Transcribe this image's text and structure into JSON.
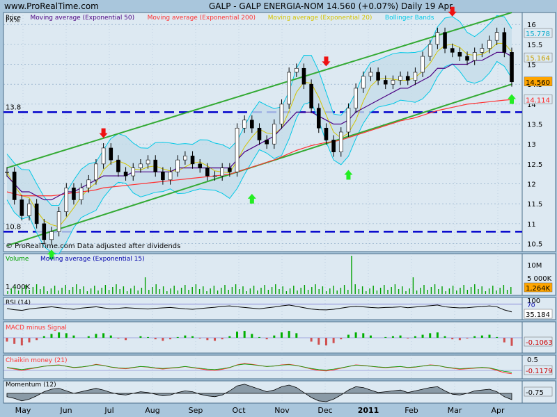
{
  "header": {
    "site": "www.ProRealTime.com",
    "title": "GALP - GALP ENERGIA-NOM   14.560 (+0.07%)   Daily  19 Apr"
  },
  "chart_data": [
    {
      "type": "line",
      "name": "price-panel",
      "legend": [
        {
          "label": "Price",
          "color": "#000000"
        },
        {
          "label": "Moving average (Exponential 50)",
          "color": "#4b0082"
        },
        {
          "label": "Moving average (Exponential 200)",
          "color": "#ff3333"
        },
        {
          "label": "Moving average (Exponential 20)",
          "color": "#d4c400"
        },
        {
          "label": "Bollinger Bands",
          "color": "#00c8e6"
        }
      ],
      "yticks": [
        10.5,
        11,
        11.5,
        12,
        12.5,
        13,
        13.5,
        14,
        14.5,
        15,
        15.5,
        16
      ],
      "ylim": [
        10.3,
        16.3
      ],
      "x_months": [
        "May",
        "Jun",
        "Jul",
        "Aug",
        "Sep",
        "Oct",
        "Nov",
        "Dec",
        "2011",
        "Feb",
        "Mar",
        "Apr"
      ],
      "horizontal_levels": [
        13.8,
        10.8
      ],
      "labels": {
        "last_price": "14.560",
        "bb_upper": "15.778",
        "bb_mid": "15.164",
        "ema200": "14.114",
        "level_hi": "13.8",
        "level_lo": "10.8",
        "note": "© ProRealTime.com  Data adjusted after dividends",
        "pct": "PX%"
      },
      "price_series": [
        12.3,
        11.6,
        11.2,
        11.5,
        11.0,
        10.6,
        10.8,
        11.3,
        11.9,
        11.6,
        11.9,
        12.1,
        12.5,
        12.9,
        12.6,
        12.3,
        12.2,
        12.4,
        12.5,
        12.6,
        12.3,
        12.1,
        12.3,
        12.6,
        12.7,
        12.5,
        12.4,
        12.2,
        12.2,
        12.4,
        12.3,
        13.4,
        13.6,
        13.4,
        13.1,
        13.0,
        13.5,
        14.0,
        14.8,
        14.9,
        14.5,
        13.9,
        13.4,
        13.1,
        12.8,
        13.3,
        13.9,
        14.4,
        14.7,
        14.8,
        14.6,
        14.5,
        14.6,
        14.7,
        14.6,
        14.8,
        15.2,
        15.5,
        15.8,
        15.4,
        15.3,
        15.2,
        15.1,
        15.3,
        15.4,
        15.6,
        15.8,
        15.3,
        14.56
      ],
      "ema50": [
        12.2,
        12.0,
        11.8,
        11.8,
        11.7,
        11.6,
        11.6,
        11.7,
        11.8,
        11.8,
        11.9,
        12.0,
        12.1,
        12.2,
        12.2,
        12.2,
        12.2,
        12.3,
        12.3,
        12.3,
        12.3,
        12.3,
        12.3,
        12.4,
        12.4,
        12.4,
        12.4,
        12.4,
        12.4,
        12.4,
        12.4,
        12.6,
        12.8,
        12.9,
        13.0,
        13.1,
        13.2,
        13.4,
        13.6,
        13.8,
        13.8,
        13.8,
        13.7,
        13.6,
        13.5,
        13.5,
        13.6,
        13.8,
        13.9,
        14.0,
        14.1,
        14.2,
        14.3,
        14.4,
        14.4,
        14.5,
        14.6,
        14.7,
        14.9,
        14.9,
        15.0,
        15.0,
        15.0,
        15.1,
        15.1,
        15.2,
        15.3,
        15.3,
        15.2
      ],
      "ema200": [
        11.8,
        11.75,
        11.7,
        11.7,
        11.7,
        11.7,
        11.7,
        11.72,
        11.75,
        11.78,
        11.8,
        11.82,
        11.85,
        11.9,
        11.92,
        11.94,
        11.96,
        11.98,
        12.0,
        12.02,
        12.04,
        12.06,
        12.08,
        12.1,
        12.12,
        12.14,
        12.16,
        12.18,
        12.2,
        12.22,
        12.24,
        12.3,
        12.36,
        12.42,
        12.48,
        12.54,
        12.6,
        12.68,
        12.76,
        12.84,
        12.9,
        12.96,
        13.0,
        13.04,
        13.06,
        13.1,
        13.16,
        13.22,
        13.28,
        13.34,
        13.4,
        13.46,
        13.52,
        13.58,
        13.62,
        13.66,
        13.72,
        13.78,
        13.84,
        13.88,
        13.92,
        13.96,
        14.0,
        14.02,
        14.04,
        14.06,
        14.08,
        14.1,
        14.114
      ],
      "channel": {
        "upper": [
          [
            0,
            12.4
          ],
          [
            68,
            16.3
          ]
        ],
        "lower": [
          [
            0,
            10.45
          ],
          [
            68,
            14.5
          ]
        ]
      },
      "arrows_down": [
        [
          13,
          13.15
        ],
        [
          43,
          14.95
        ],
        [
          60,
          16.2
        ]
      ],
      "arrows_up": [
        [
          6,
          10.35
        ],
        [
          33,
          11.75
        ],
        [
          46,
          12.35
        ],
        [
          68,
          14.25
        ]
      ]
    },
    {
      "type": "bar",
      "name": "volume-panel",
      "legend": [
        {
          "label": "Volume",
          "color": "#00a000"
        },
        {
          "label": "Moving average (Exponential 15)",
          "color": "#0000aa"
        }
      ],
      "yticks_labels": [
        "10M",
        "5 000K",
        "1,400K"
      ],
      "last_label": "1,264K"
    },
    {
      "type": "line",
      "name": "rsi-panel",
      "legend": [
        {
          "label": "RSI (14)",
          "color": "#000000"
        }
      ],
      "ticks": [
        "100",
        "70"
      ],
      "last_label": "35.184",
      "values": [
        50,
        45,
        42,
        48,
        52,
        55,
        58,
        54,
        50,
        47,
        52,
        55,
        58,
        53,
        49,
        51,
        54,
        52,
        50,
        48,
        51,
        53,
        55,
        52,
        49,
        47,
        50,
        53,
        56,
        60,
        62,
        58,
        55,
        52,
        49,
        53,
        57,
        62,
        66,
        60,
        54,
        48,
        45,
        44,
        47,
        52,
        57,
        60,
        58,
        55,
        53,
        55,
        56,
        58,
        54,
        57,
        60,
        63,
        66,
        58,
        55,
        53,
        54,
        57,
        59,
        62,
        58,
        44,
        35.184
      ]
    },
    {
      "type": "bar",
      "name": "macd-panel",
      "legend": [
        {
          "label": "MACD minus Signal",
          "color": "#ff3333"
        }
      ],
      "last_label": "-0.1063",
      "values": [
        -0.05,
        -0.08,
        -0.1,
        -0.06,
        -0.03,
        0.02,
        0.05,
        0.07,
        0.06,
        0.03,
        0.0,
        0.02,
        0.05,
        0.06,
        0.03,
        -0.01,
        -0.03,
        0.0,
        0.02,
        0.01,
        -0.02,
        -0.04,
        -0.02,
        0.01,
        0.03,
        0.02,
        -0.01,
        -0.03,
        -0.04,
        -0.02,
        0.02,
        0.08,
        0.09,
        0.05,
        0.01,
        -0.02,
        0.03,
        0.07,
        0.09,
        0.06,
        0.0,
        -0.05,
        -0.09,
        -0.1,
        -0.07,
        -0.02,
        0.04,
        0.07,
        0.06,
        0.03,
        0.0,
        0.01,
        0.02,
        0.03,
        -0.01,
        0.02,
        0.04,
        0.06,
        0.07,
        0.02,
        -0.02,
        -0.03,
        -0.01,
        0.02,
        0.03,
        0.04,
        0.01,
        -0.06,
        -0.1063
      ]
    },
    {
      "type": "line",
      "name": "chaikin-panel",
      "legend": [
        {
          "label": "Chaikin money (21)",
          "color": "#ff3333"
        }
      ],
      "ticks": [
        "0.5",
        "0"
      ],
      "last_label": "-0.1179",
      "values": [
        0.1,
        0.05,
        0.0,
        0.05,
        0.1,
        0.15,
        0.18,
        0.2,
        0.15,
        0.1,
        0.12,
        0.16,
        0.22,
        0.18,
        0.12,
        0.08,
        0.06,
        0.1,
        0.14,
        0.12,
        0.08,
        0.05,
        0.08,
        0.1,
        0.14,
        0.1,
        0.06,
        0.02,
        0.0,
        0.04,
        0.1,
        0.2,
        0.25,
        0.22,
        0.18,
        0.14,
        0.16,
        0.2,
        0.22,
        0.18,
        0.12,
        0.05,
        0.0,
        -0.02,
        0.02,
        0.08,
        0.14,
        0.2,
        0.18,
        0.15,
        0.12,
        0.1,
        0.12,
        0.14,
        0.1,
        0.12,
        0.16,
        0.2,
        0.18,
        0.12,
        0.08,
        0.04,
        0.06,
        0.08,
        0.1,
        0.08,
        0.0,
        -0.08,
        -0.1179
      ]
    },
    {
      "type": "area",
      "name": "momentum-panel",
      "legend": [
        {
          "label": "Momentum (12)",
          "color": "#000000"
        }
      ],
      "last_label": "-0.75",
      "values": [
        -0.4,
        -0.6,
        -0.9,
        -0.7,
        -0.3,
        0.2,
        0.5,
        0.6,
        0.3,
        0.0,
        0.2,
        0.4,
        0.6,
        0.4,
        0.1,
        -0.1,
        -0.2,
        0.0,
        0.2,
        0.1,
        -0.1,
        -0.3,
        -0.2,
        0.1,
        0.3,
        0.2,
        -0.1,
        -0.3,
        -0.4,
        -0.2,
        0.3,
        0.9,
        1.1,
        0.8,
        0.5,
        0.2,
        0.4,
        0.8,
        1.0,
        0.7,
        0.1,
        -0.5,
        -0.9,
        -1.0,
        -0.7,
        -0.2,
        0.4,
        0.8,
        0.7,
        0.4,
        0.1,
        0.2,
        0.3,
        0.4,
        0.1,
        0.3,
        0.5,
        0.7,
        0.8,
        0.3,
        -0.1,
        -0.2,
        0.0,
        0.3,
        0.4,
        0.5,
        0.2,
        -0.4,
        -0.75
      ]
    }
  ]
}
